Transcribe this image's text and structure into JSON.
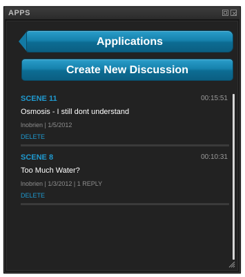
{
  "window": {
    "title": "APPS"
  },
  "buttons": {
    "applications": "Applications",
    "create_discussion": "Create New Discussion"
  },
  "discussions": [
    {
      "scene": "SCENE 11",
      "time": "00:15:51",
      "subject": "Osmosis - I still dont understand",
      "meta": "lnobrien | 1/5/2012",
      "delete": "DELETE"
    },
    {
      "scene": "SCENE 8",
      "time": "00:10:31",
      "subject": "Too Much Water?",
      "meta": "lnobrien | 1/3/2012 | 1 REPLY",
      "delete": "DELETE"
    }
  ],
  "icons": {
    "restore": "restore-icon",
    "close": "close-icon",
    "back": "back-arrow-icon",
    "resize": "resize-grip-icon"
  },
  "colors": {
    "accent": "#1f9ad0",
    "button": "#1682ad",
    "background": "#222222"
  }
}
